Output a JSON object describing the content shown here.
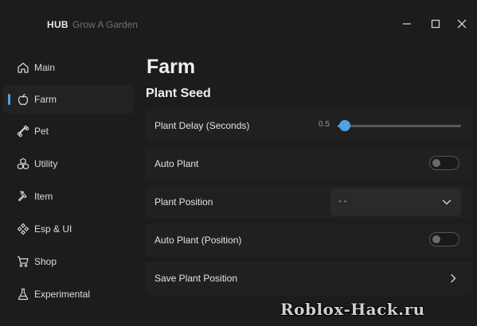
{
  "titlebar": {
    "brand": "HUB",
    "subtitle": "Grow A Garden"
  },
  "sidebar": {
    "items": [
      {
        "label": "Main",
        "icon": "home-icon"
      },
      {
        "label": "Farm",
        "icon": "apple-icon",
        "active": true
      },
      {
        "label": "Pet",
        "icon": "bone-icon"
      },
      {
        "label": "Utility",
        "icon": "cubes-icon"
      },
      {
        "label": "Item",
        "icon": "hammer-icon"
      },
      {
        "label": "Esp & UI",
        "icon": "diamond-grid-icon"
      },
      {
        "label": "Shop",
        "icon": "cart-icon"
      },
      {
        "label": "Experimental",
        "icon": "flask-icon"
      }
    ]
  },
  "main": {
    "title": "Farm",
    "section": "Plant Seed",
    "rows": {
      "plant_delay": {
        "label": "Plant Delay (Seconds)",
        "value": "0.5",
        "fraction": 0.06
      },
      "auto_plant": {
        "label": "Auto Plant",
        "enabled": false
      },
      "plant_position": {
        "label": "Plant Position",
        "selected": "- -"
      },
      "auto_plant_position": {
        "label": "Auto Plant (Position)",
        "enabled": false
      },
      "save_plant_position": {
        "label": "Save Plant Position"
      }
    }
  },
  "watermark": "Roblox-Hack.ru",
  "colors": {
    "accent": "#4ea3e6",
    "background": "#1c1c1c",
    "row_background": "#202020"
  }
}
